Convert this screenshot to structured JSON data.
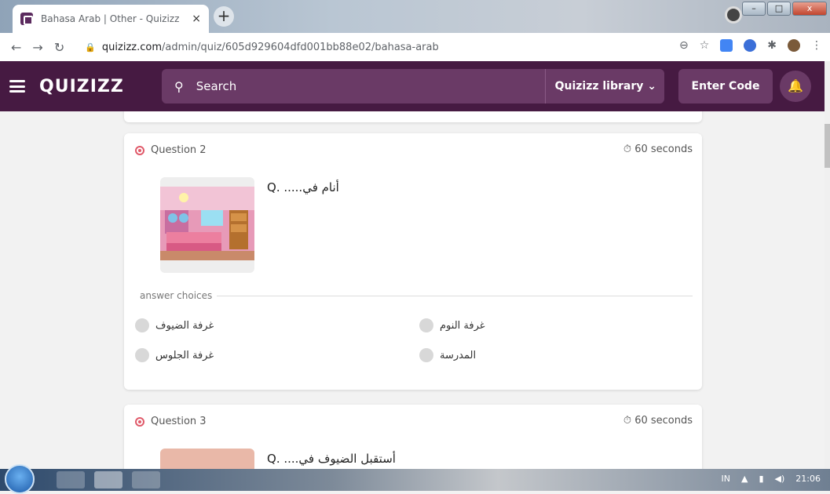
{
  "browser": {
    "tab_title": "Bahasa Arab | Other - Quizizz",
    "tab_close": "×",
    "new_tab": "+",
    "url": "quizizz.com",
    "url_path": "/admin/quiz/605d929604dfd001bb88e02/bahasa-arab",
    "win_min": "–",
    "win_max": "□",
    "win_close": "x"
  },
  "header": {
    "logo": "QUIZIZZ",
    "search_label": "Search",
    "library_label": "Quizizz library",
    "enter_code": "Enter Code"
  },
  "questions": [
    {
      "label": "Question 2",
      "time": "60 seconds",
      "text": "أنام في..... .Q",
      "answers_label": "answer choices",
      "answers": [
        "غرفة الضيوف",
        "غرفة النوم",
        "غرفة الجلوس",
        "المدرسة"
      ]
    },
    {
      "label": "Question 3",
      "time": "60 seconds",
      "text": "أستقبل الضيوف في.... .Q"
    }
  ],
  "taskbar": {
    "lang": "IN",
    "time": "21:06"
  },
  "colors": {
    "brand": "#461a42",
    "brand_light": "#6a3a66"
  }
}
